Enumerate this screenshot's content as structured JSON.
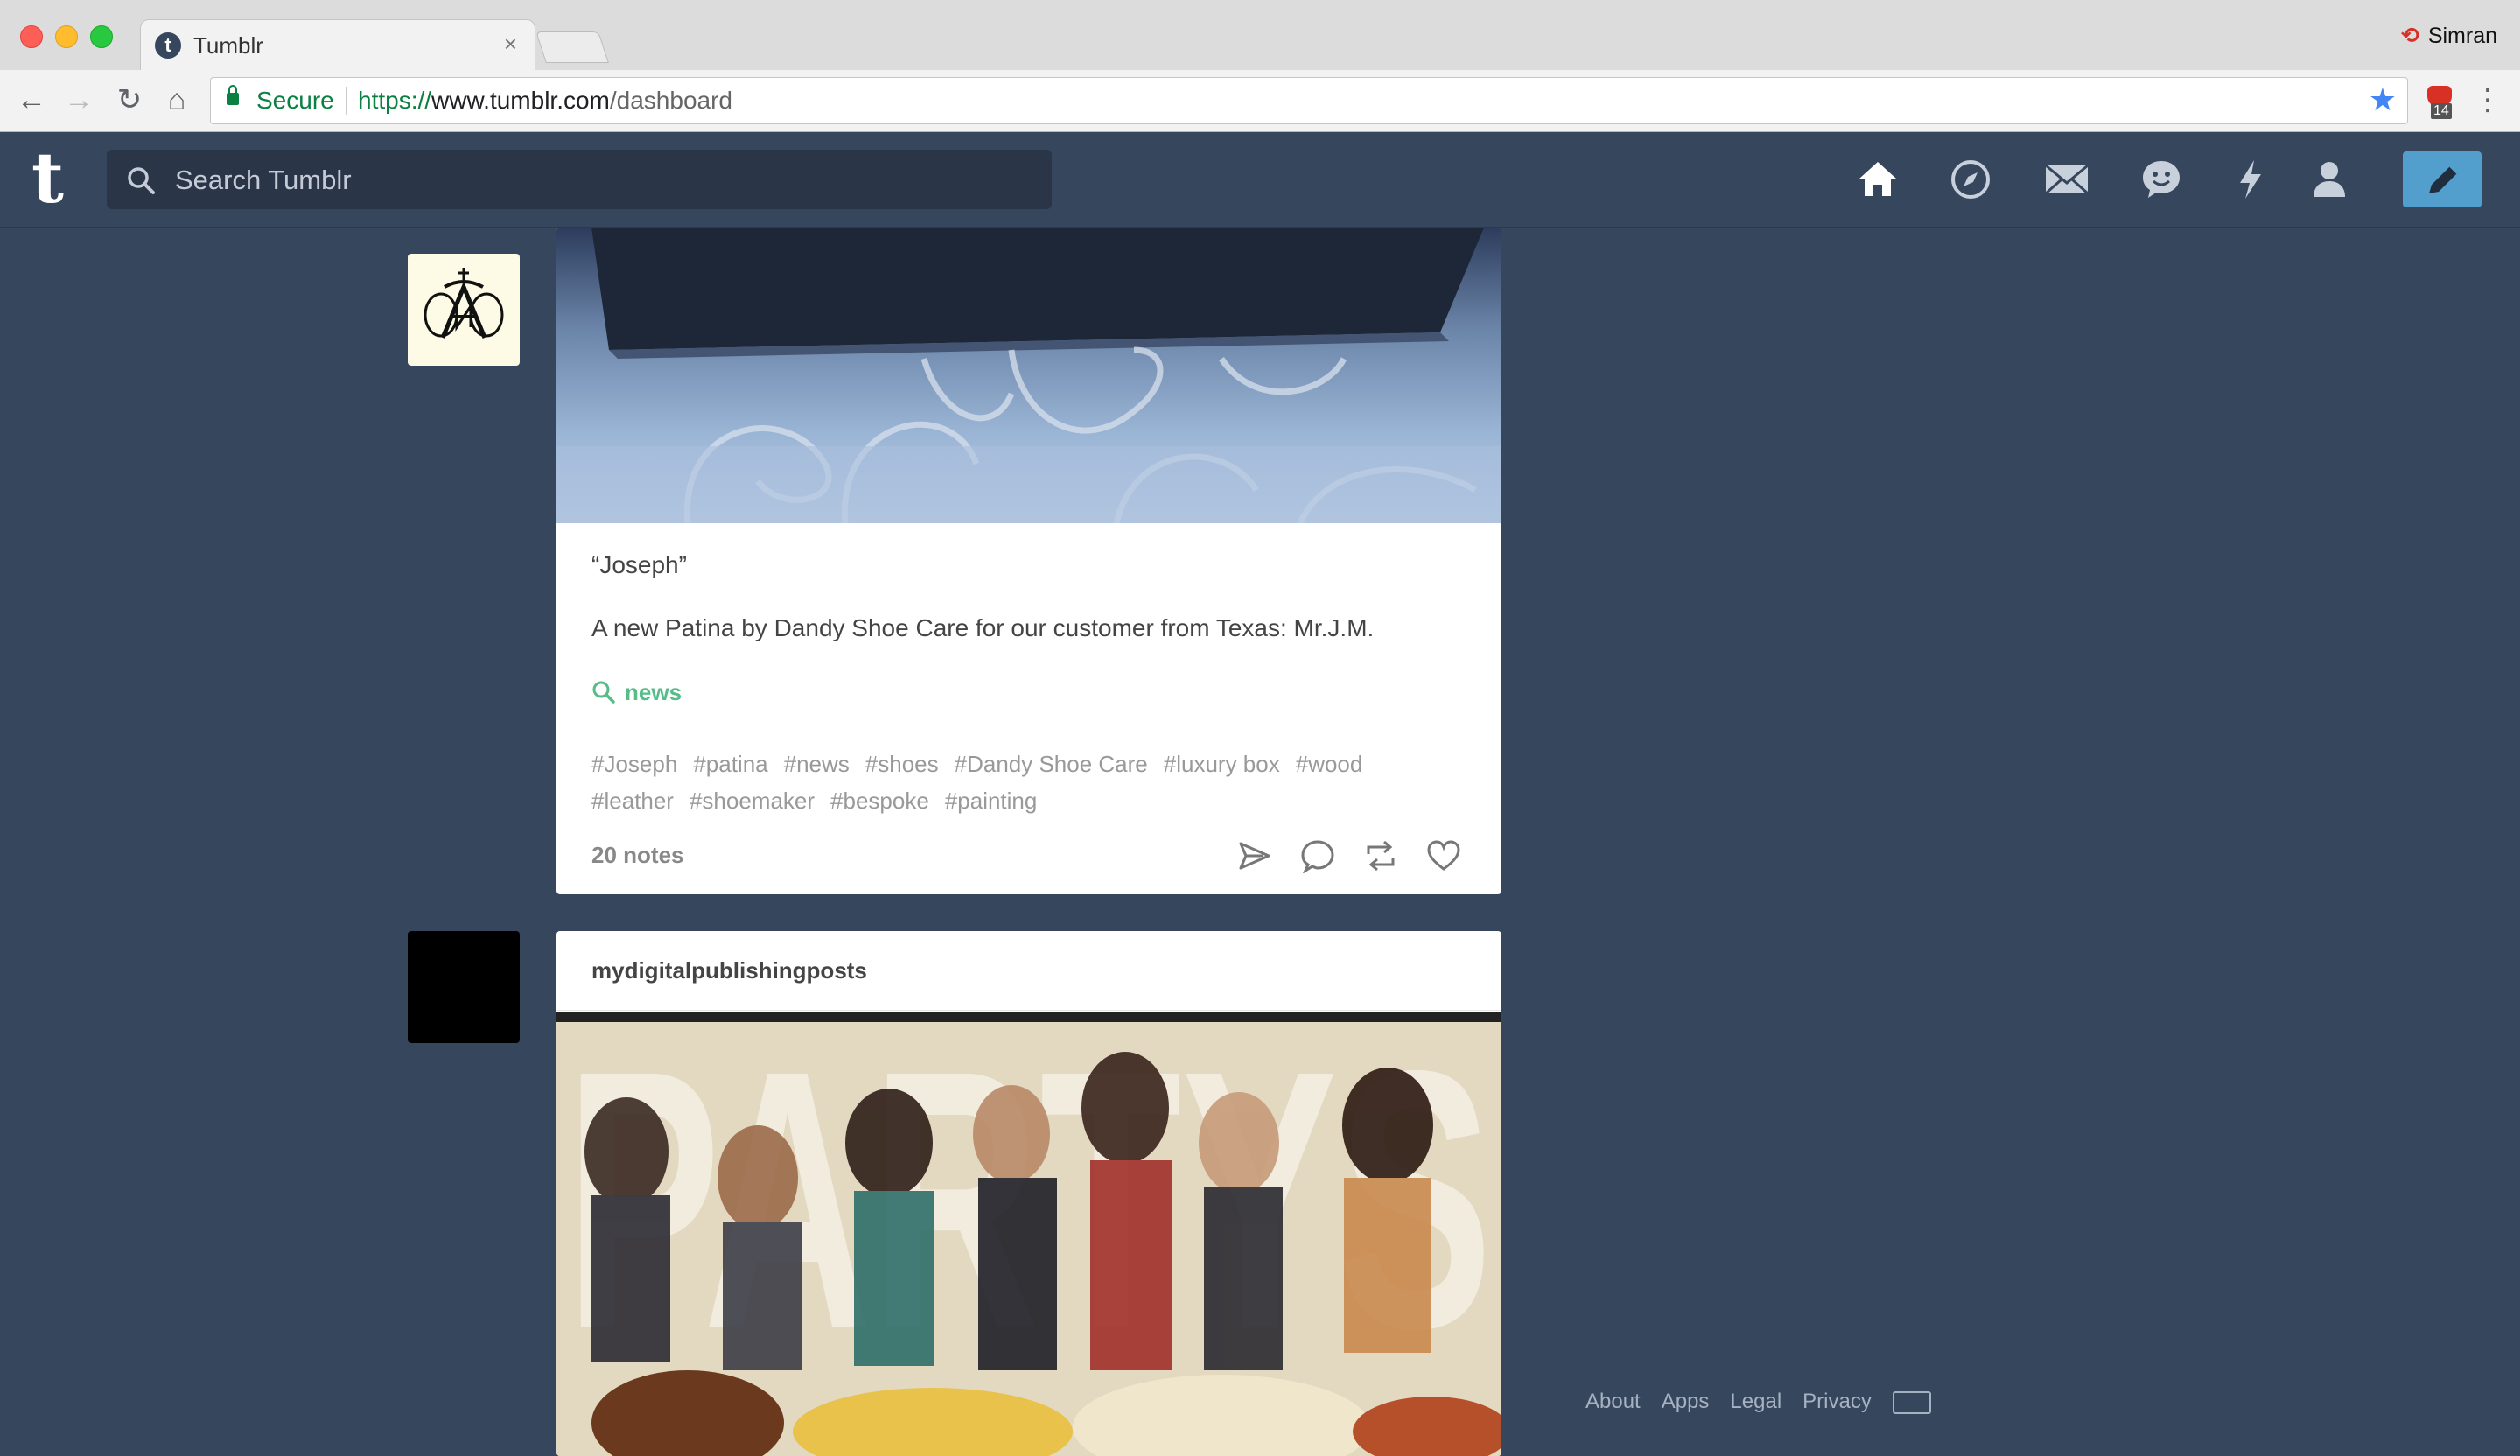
{
  "browser": {
    "tab_title": "Tumblr",
    "tab_close": "×",
    "profile_name": "Simran",
    "secure_label": "Secure",
    "url_scheme": "https://",
    "url_host": "www.tumblr.com",
    "url_path": "/dashboard",
    "extension_badge": "14"
  },
  "header": {
    "logo": "t",
    "search_placeholder": "Search Tumblr",
    "icons": [
      "home-icon",
      "explore-icon",
      "inbox-icon",
      "messaging-icon",
      "activity-icon",
      "account-icon",
      "compose-icon"
    ],
    "accent_color": "#529ecc",
    "background_color": "#36465d"
  },
  "posts": [
    {
      "title": "“Joseph”",
      "body": "A new Patina by Dandy Shoe Care for our customer from Texas: Mr.J.M.",
      "source_label": "news",
      "tags": [
        "#Joseph",
        "#patina",
        "#news",
        "#shoes",
        "#Dandy Shoe Care",
        "#luxury box",
        "#wood",
        "#leather",
        "#shoemaker",
        "#bespoke",
        "#painting"
      ],
      "notes": "20 notes",
      "actions": [
        "share-icon",
        "reply-icon",
        "reblog-icon",
        "like-icon"
      ]
    },
    {
      "blog_name": "mydigitalpublishingposts",
      "photo_text": "PARTYS"
    }
  ],
  "footer": {
    "links": [
      "About",
      "Apps",
      "Legal",
      "Privacy"
    ]
  }
}
